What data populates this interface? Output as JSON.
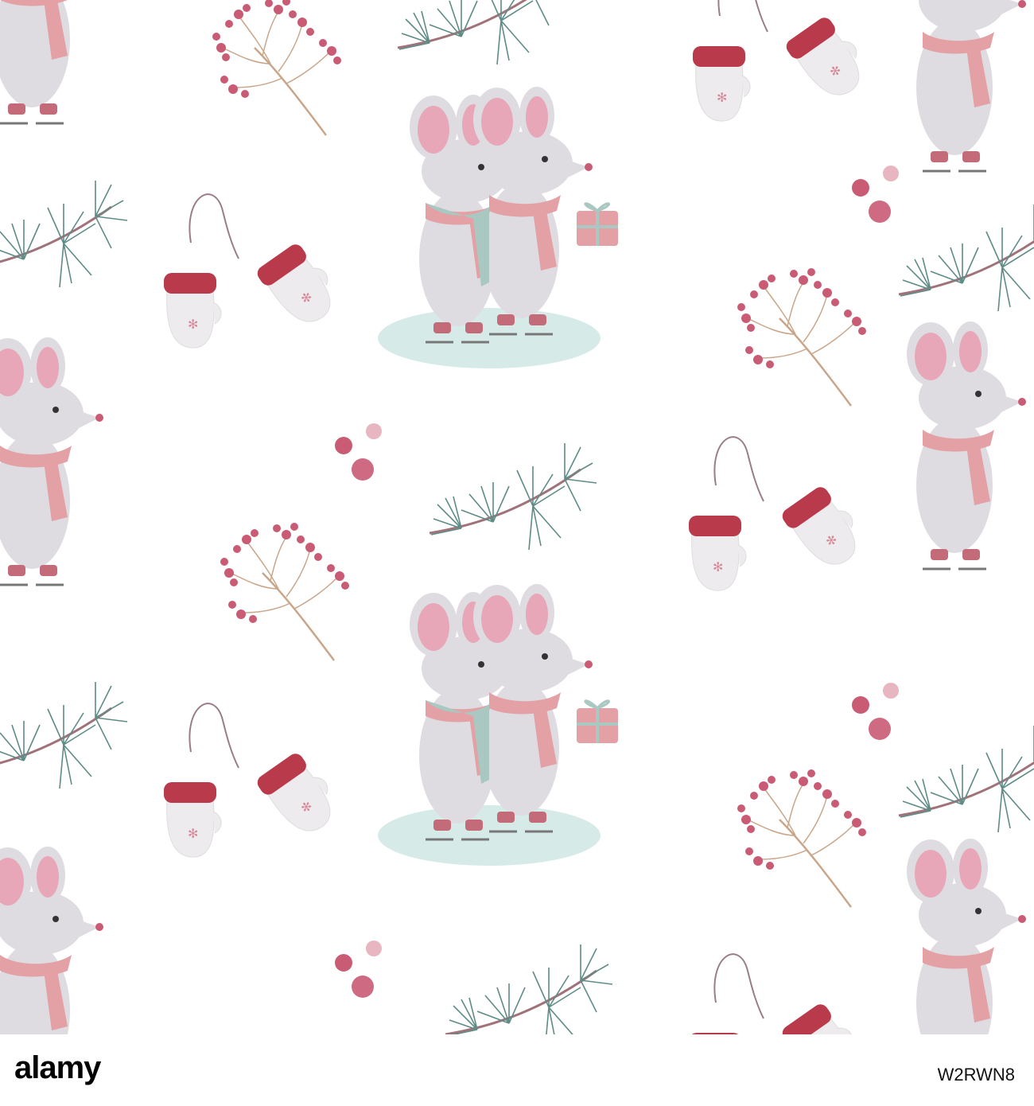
{
  "image": {
    "description_colors": {
      "background": "#ffffff",
      "mouse_fur": "#d9d7db",
      "ear_inner": "#e7a7b8",
      "pink_scarf": "#e3a0a5",
      "teal_scarf": "#a9c8c2",
      "ice": "#d6ebe8",
      "berry": "#c95b74",
      "mitten_cuff": "#b93a4a",
      "pine": "#5e8c86",
      "twig": "#c9a68a"
    }
  },
  "footer": {
    "logo": "alamy",
    "stock_id": "W2RWN8"
  }
}
